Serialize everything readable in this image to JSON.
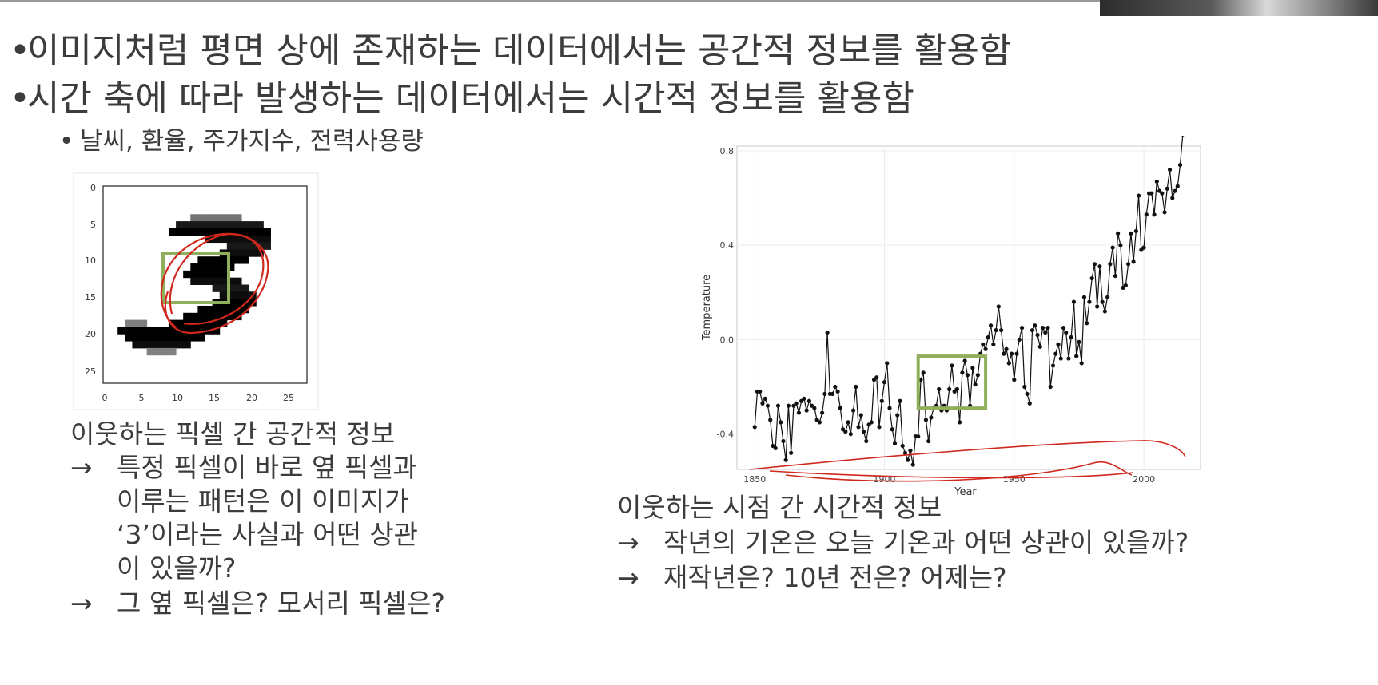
{
  "bullets": [
    "이미지처럼 평면 상에 존재하는 데이터에서는 공간적 정보를 활용함",
    "시간 축에 따라 발생하는 데이터에서는 시간적 정보를 활용함"
  ],
  "bullet_marker": "•",
  "sub_marker": "•",
  "sub_bullet": "날씨, 환율, 주가지수, 전력사용량",
  "arrow": "→",
  "left_caption": {
    "title": "이웃하는 픽셀 간 공간적 정보",
    "arrow1_line1": "특정 픽셀이 바로 옆 픽셀과",
    "arrow1_line2": "이루는 패턴은 이 이미지가",
    "arrow1_line3": "‘3’이라는 사실과 어떤 상관",
    "arrow1_line4": "이 있을까?",
    "arrow2": "그 옆 픽셀은? 모서리 픽셀은?"
  },
  "right_caption": {
    "title": "이웃하는 시점 간 시간적 정보",
    "arrow1": "작년의 기온은 오늘 기온과 어떤 상관이 있을까?",
    "arrow2": "재작년은? 10년 전은? 어제는?"
  },
  "digit_image": {
    "x_ticks": [
      "0",
      "5",
      "10",
      "15",
      "20",
      "25"
    ],
    "y_ticks": [
      "0",
      "5",
      "10",
      "15",
      "20",
      "25"
    ],
    "highlight_color": "#8faf5a",
    "annotation_color": "#d0281c"
  },
  "chart_data": {
    "type": "line",
    "xlabel": "Year",
    "ylabel": "Temperature",
    "xlim": [
      1845,
      2020
    ],
    "ylim": [
      -0.55,
      0.82
    ],
    "x_ticks": [
      1850,
      1900,
      1950,
      2000
    ],
    "y_ticks": [
      -0.4,
      0.0,
      0.4,
      0.8
    ],
    "y_tick_labels": [
      "-0.4",
      "0.0",
      "0.4",
      "0.8"
    ],
    "grid": true,
    "line_color": "#111111",
    "highlight_color": "#8faf5a",
    "highlight_range": {
      "x": [
        1913,
        1939
      ],
      "y": [
        -0.29,
        -0.07
      ]
    },
    "series": [
      {
        "x": [
          1850,
          1851,
          1852,
          1853,
          1854,
          1855,
          1856,
          1857,
          1858,
          1859,
          1860,
          1861,
          1862,
          1863,
          1864,
          1865,
          1866,
          1867,
          1868,
          1869,
          1870,
          1871,
          1872,
          1873,
          1874,
          1875,
          1876,
          1877,
          1878,
          1879,
          1880,
          1881,
          1882,
          1883,
          1884,
          1885,
          1886,
          1887,
          1888,
          1889,
          1890,
          1891,
          1892,
          1893,
          1894,
          1895,
          1896,
          1897,
          1898,
          1899,
          1900,
          1901,
          1902,
          1903,
          1904,
          1905,
          1906,
          1907,
          1908,
          1909,
          1910,
          1911,
          1912,
          1913,
          1914,
          1915,
          1916,
          1917,
          1918,
          1919,
          1920,
          1921,
          1922,
          1923,
          1924,
          1925,
          1926,
          1927,
          1928,
          1929,
          1930,
          1931,
          1932,
          1933,
          1934,
          1935,
          1936,
          1937,
          1938,
          1939,
          1940,
          1941,
          1942,
          1943,
          1944,
          1945,
          1946,
          1947,
          1948,
          1949,
          1950,
          1951,
          1952,
          1953,
          1954,
          1955,
          1956,
          1957,
          1958,
          1959,
          1960,
          1961,
          1962,
          1963,
          1964,
          1965,
          1966,
          1967,
          1968,
          1969,
          1970,
          1971,
          1972,
          1973,
          1974,
          1975,
          1976,
          1977,
          1978,
          1979,
          1980,
          1981,
          1982,
          1983,
          1984,
          1985,
          1986,
          1987,
          1988,
          1989,
          1990,
          1991,
          1992,
          1993,
          1994,
          1995,
          1996,
          1997,
          1998,
          1999,
          2000,
          2001,
          2002,
          2003,
          2004,
          2005,
          2006,
          2007,
          2008,
          2009,
          2010,
          2011,
          2012,
          2013,
          2014,
          2015,
          2016
        ],
        "y": [
          -0.37,
          -0.22,
          -0.22,
          -0.27,
          -0.25,
          -0.28,
          -0.34,
          -0.45,
          -0.46,
          -0.28,
          -0.35,
          -0.43,
          -0.51,
          -0.28,
          -0.48,
          -0.28,
          -0.27,
          -0.31,
          -0.26,
          -0.25,
          -0.3,
          -0.26,
          -0.28,
          -0.29,
          -0.34,
          -0.35,
          -0.31,
          -0.23,
          0.03,
          -0.23,
          -0.23,
          -0.2,
          -0.22,
          -0.29,
          -0.38,
          -0.39,
          -0.35,
          -0.4,
          -0.3,
          -0.2,
          -0.37,
          -0.32,
          -0.39,
          -0.43,
          -0.36,
          -0.35,
          -0.17,
          -0.16,
          -0.37,
          -0.26,
          -0.18,
          -0.1,
          -0.29,
          -0.38,
          -0.44,
          -0.32,
          -0.26,
          -0.45,
          -0.48,
          -0.51,
          -0.47,
          -0.53,
          -0.41,
          -0.41,
          -0.17,
          -0.14,
          -0.34,
          -0.43,
          -0.33,
          -0.29,
          -0.28,
          -0.21,
          -0.3,
          -0.28,
          -0.3,
          -0.21,
          -0.11,
          -0.22,
          -0.21,
          -0.35,
          -0.14,
          -0.09,
          -0.15,
          -0.28,
          -0.12,
          -0.19,
          -0.15,
          -0.06,
          -0.02,
          -0.04,
          0.01,
          0.06,
          -0.02,
          0.04,
          0.14,
          0.04,
          -0.06,
          -0.04,
          -0.1,
          -0.06,
          -0.17,
          -0.06,
          0.0,
          0.05,
          -0.2,
          -0.23,
          -0.27,
          0.04,
          0.06,
          0.02,
          -0.03,
          0.05,
          0.03,
          0.05,
          -0.2,
          -0.11,
          -0.06,
          -0.02,
          -0.08,
          0.05,
          0.03,
          -0.08,
          0.01,
          0.16,
          -0.07,
          -0.01,
          -0.1,
          0.18,
          0.07,
          0.16,
          0.26,
          0.32,
          0.14,
          0.31,
          0.16,
          0.12,
          0.18,
          0.32,
          0.39,
          0.27,
          0.45,
          0.4,
          0.22,
          0.23,
          0.32,
          0.45,
          0.33,
          0.46,
          0.61,
          0.38,
          0.39,
          0.53,
          0.62,
          0.62,
          0.53,
          0.67,
          0.63,
          0.62,
          0.54,
          0.64,
          0.72,
          0.6,
          0.63,
          0.65,
          0.74,
          0.87,
          0.99
        ]
      }
    ]
  }
}
